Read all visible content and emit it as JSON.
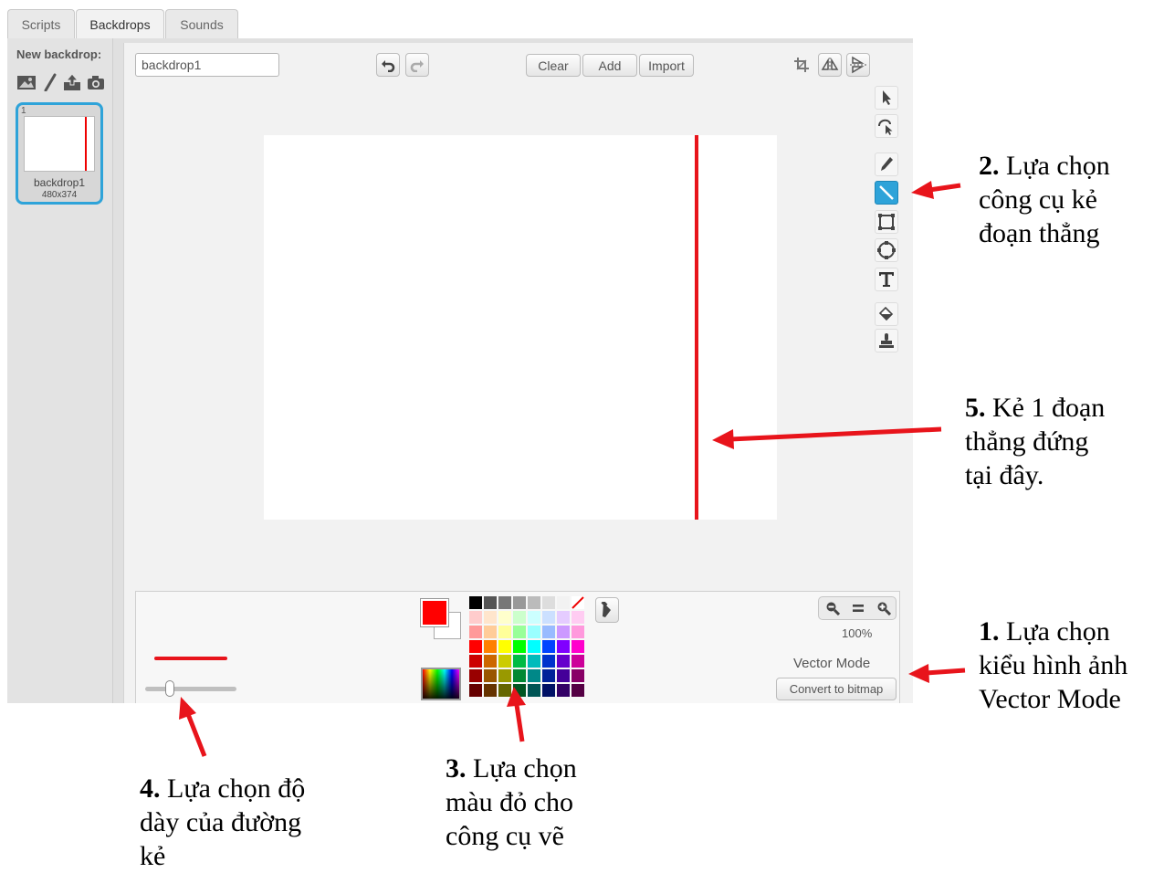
{
  "tabs": [
    {
      "label": "Scripts",
      "active": false
    },
    {
      "label": "Backdrops",
      "active": true
    },
    {
      "label": "Sounds",
      "active": false
    }
  ],
  "backdrop_pane": {
    "new_backdrop_label": "New backdrop:",
    "new_backdrop_icons": [
      "image-library-icon",
      "paint-brush-icon",
      "upload-icon",
      "camera-icon"
    ],
    "thumbnail": {
      "number": "1",
      "name": "backdrop1",
      "size": "480x374"
    }
  },
  "editor": {
    "name_value": "backdrop1",
    "undo_icon": "undo-icon",
    "redo_icon": "redo-icon",
    "buttons": {
      "clear": "Clear",
      "add": "Add",
      "import": "Import"
    },
    "right_icons": [
      "crop-icon",
      "flip-horizontal-icon",
      "flip-vertical-icon"
    ],
    "tools": [
      "select",
      "reshape",
      "pencil",
      "line",
      "rectangle",
      "ellipse",
      "text",
      "fill",
      "stamp"
    ],
    "selected_tool": "line"
  },
  "colors": {
    "primary": "#ff0000",
    "secondary": "#ffffff",
    "stroke": "#e8141b",
    "accent": "#2ea3d9"
  },
  "zoom": {
    "percent": "100%"
  },
  "mode": {
    "label": "Vector Mode",
    "convert_button": "Convert to bitmap"
  },
  "annotations": {
    "a2": {
      "num": "2.",
      "lines": [
        "Lựa chọn",
        "công cụ kẻ",
        "đoạn thẳng"
      ]
    },
    "a5": {
      "num": "5.",
      "lines": [
        "Kẻ 1 đoạn",
        "thẳng đứng",
        "tại đây."
      ]
    },
    "a1": {
      "num": "1.",
      "lines": [
        "Lựa chọn",
        "kiểu hình ảnh",
        "Vector Mode"
      ]
    },
    "a4": {
      "num": "4.",
      "lines": [
        "Lựa chọn độ",
        "dày của đường",
        "kẻ"
      ]
    },
    "a3": {
      "num": "3.",
      "lines": [
        "Lựa chọn",
        "màu đỏ cho",
        "công cụ vẽ"
      ]
    }
  }
}
